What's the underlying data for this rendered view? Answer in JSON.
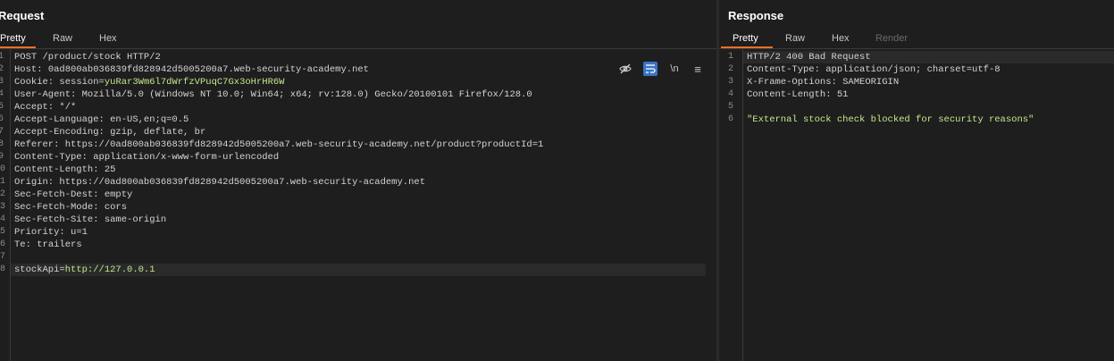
{
  "request": {
    "title": "Request",
    "tabs": [
      "Pretty",
      "Raw",
      "Hex"
    ],
    "active_tab": "Pretty",
    "toolbar": {
      "hide_icon": "eye-off-icon",
      "wrap_icon": "wrap-lines-icon",
      "newline_label": "\\n",
      "menu_icon": "hamburger-menu-icon"
    },
    "lines": [
      {
        "n": "1",
        "name": "POST /product/stock HTTP/2",
        "value": ""
      },
      {
        "n": "2",
        "name": "Host: ",
        "value": "0ad800ab036839fd828942d5005200a7.web-security-academy.net"
      },
      {
        "n": "3",
        "name": "Cookie: ",
        "value": "session=",
        "extra": "yuRar3Wm6l7dWrfzVPuqC7Gx3oHrHR6W"
      },
      {
        "n": "4",
        "name": "User-Agent: ",
        "value": "Mozilla/5.0 (Windows NT 10.0; Win64; x64; rv:128.0) Gecko/20100101 Firefox/128.0"
      },
      {
        "n": "5",
        "name": "Accept: ",
        "value": "*/*"
      },
      {
        "n": "6",
        "name": "Accept-Language: ",
        "value": "en-US,en;q=0.5"
      },
      {
        "n": "7",
        "name": "Accept-Encoding: ",
        "value": "gzip, deflate, br"
      },
      {
        "n": "8",
        "name": "Referer: ",
        "value": "https://0ad800ab036839fd828942d5005200a7.web-security-academy.net/product?productId=1"
      },
      {
        "n": "9",
        "name": "Content-Type: ",
        "value": "application/x-www-form-urlencoded"
      },
      {
        "n": "10",
        "name": "Content-Length: ",
        "value": "25"
      },
      {
        "n": "11",
        "name": "Origin: ",
        "value": "https://0ad800ab036839fd828942d5005200a7.web-security-academy.net"
      },
      {
        "n": "12",
        "name": "Sec-Fetch-Dest: ",
        "value": "empty"
      },
      {
        "n": "13",
        "name": "Sec-Fetch-Mode: ",
        "value": "cors"
      },
      {
        "n": "14",
        "name": "Sec-Fetch-Site: ",
        "value": "same-origin"
      },
      {
        "n": "15",
        "name": "Priority: ",
        "value": "u=1"
      },
      {
        "n": "16",
        "name": "Te: ",
        "value": "trailers"
      },
      {
        "n": "17",
        "name": "",
        "value": ""
      },
      {
        "n": "18",
        "name": "stockApi=",
        "value": "",
        "extra": "http://127.0.0.1"
      }
    ]
  },
  "response": {
    "title": "Response",
    "tabs": [
      "Pretty",
      "Raw",
      "Hex",
      "Render"
    ],
    "active_tab": "Pretty",
    "lines": [
      {
        "n": "1",
        "text": "HTTP/2 400 Bad Request"
      },
      {
        "n": "2",
        "text": "Content-Type: application/json; charset=utf-8"
      },
      {
        "n": "3",
        "text": "X-Frame-Options: SAMEORIGIN"
      },
      {
        "n": "4",
        "text": "Content-Length: 51"
      },
      {
        "n": "5",
        "text": ""
      },
      {
        "n": "6",
        "text": "\"External stock check blocked for security reasons\""
      }
    ]
  }
}
